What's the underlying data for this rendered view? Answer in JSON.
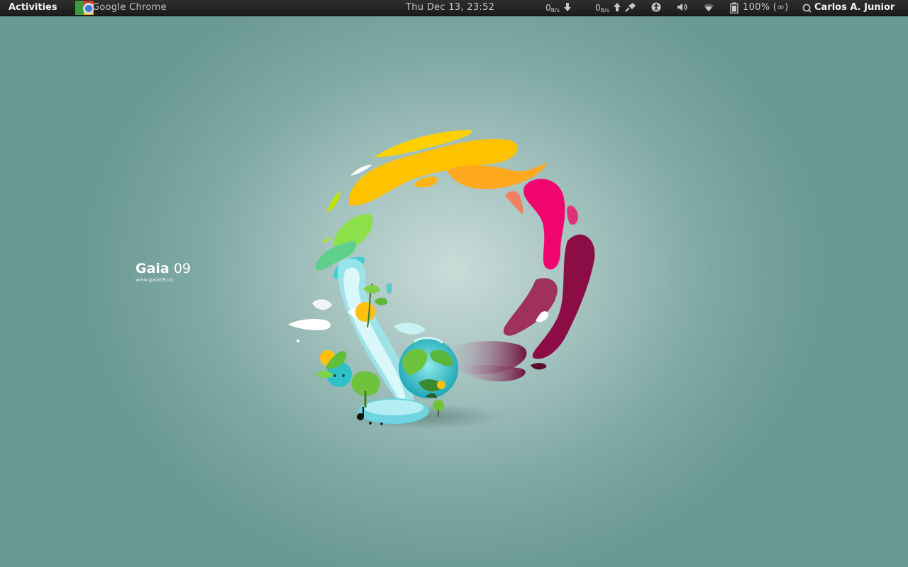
{
  "topbar": {
    "activities_label": "Activities",
    "app_menu_label": "Google Chrome",
    "clock": "Thu Dec 13, 23:52",
    "net_down_value": "0",
    "net_down_unit": "B/s",
    "net_up_value": "0",
    "net_up_unit": "B/s",
    "battery_label": "100% (∞)",
    "user_name": "Carlos A. Junior"
  },
  "icons": {
    "app": "google-chrome-icon",
    "net_down": "arrow-down-icon",
    "net_up": "arrow-up-icon",
    "disconnect": "plug-icon",
    "accessibility": "accessibility-icon",
    "volume": "volume-icon",
    "wifi": "wifi-icon",
    "battery": "battery-icon",
    "user_status": "user-status-icon"
  },
  "wallpaper": {
    "brand_name": "Gaia",
    "brand_number": "09",
    "brand_url": "www.gaia09.us"
  },
  "colors": {
    "topbar_bg": "#1f1f1f",
    "desktop_bg": "#6b9996",
    "desktop_center": "#c9dcd8"
  }
}
